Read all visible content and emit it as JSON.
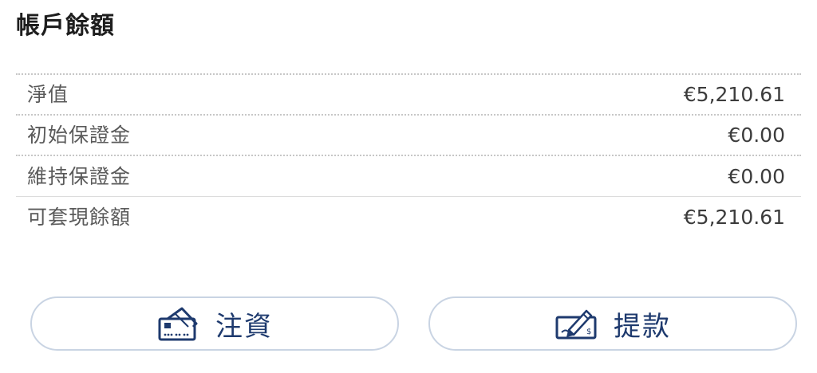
{
  "account": {
    "title": "帳戶餘額",
    "rows": [
      {
        "label": "淨值",
        "value": "€5,210.61"
      },
      {
        "label": "初始保證金",
        "value": "€0.00"
      },
      {
        "label": "維持保證金",
        "value": "€0.00"
      },
      {
        "label": "可套現餘額",
        "value": "€5,210.61"
      }
    ]
  },
  "actions": {
    "deposit_label": "注資",
    "deposit_icon": "card-deposit-icon",
    "withdraw_label": "提款",
    "withdraw_icon": "cheque-withdraw-icon"
  },
  "colors": {
    "accent": "#1e3a6e",
    "button_border": "#c9d4e3",
    "divider": "#c7c7c7"
  }
}
